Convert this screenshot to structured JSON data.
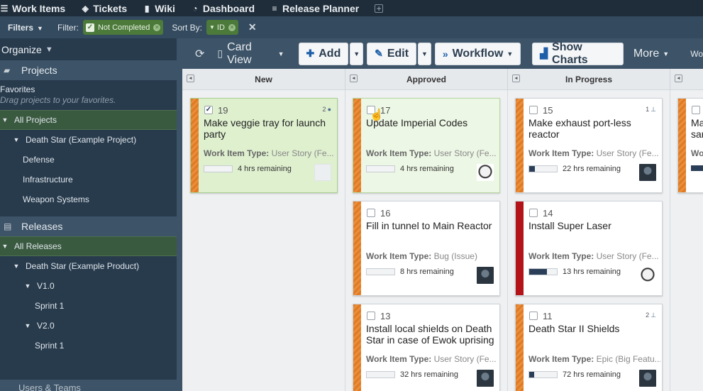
{
  "nav": {
    "tabs": [
      {
        "label": "Work Items",
        "icon": "list-icon"
      },
      {
        "label": "Tickets",
        "icon": "ticket-icon"
      },
      {
        "label": "Wiki",
        "icon": "document-icon"
      },
      {
        "label": "Dashboard",
        "icon": "dashboard-icon"
      },
      {
        "label": "Release Planner",
        "icon": "planner-icon"
      }
    ],
    "add_tab_icon": "plus-icon"
  },
  "filterbar": {
    "filters_label": "Filters",
    "filter_label": "Filter:",
    "filter_value": "Not Completed",
    "sortby_label": "Sort By:",
    "sort_value": "ID"
  },
  "sidebar": {
    "organize_label": "Organize",
    "projects_label": "Projects",
    "favorites_title": "Favorites",
    "favorites_hint": "Drag projects to your favorites.",
    "all_projects": "All Projects",
    "project_items": [
      "Death Star (Example Project)",
      "Defense",
      "Infrastructure",
      "Weapon Systems"
    ],
    "releases_label": "Releases",
    "all_releases": "All Releases",
    "release_items": [
      "Death Star (Example Product)",
      "V1.0",
      "Sprint 1",
      "V2.0",
      "Sprint 1"
    ],
    "users_label": "Users & Teams"
  },
  "toolbar": {
    "view_label": "Card View",
    "add_label": "Add",
    "edit_label": "Edit",
    "workflow_label": "Workflow",
    "charts_label": "Show Charts",
    "more_label": "More",
    "cut_label": "Wo"
  },
  "columns": [
    "New",
    "Approved",
    "In Progress"
  ],
  "cards": {
    "c19": {
      "id": "19",
      "title": "Make veggie tray for launch party",
      "type_label": "Work Item Type:",
      "type_value": "User Story (Fe...",
      "remaining": "4 hrs remaining",
      "badge": "2",
      "checked": "✓",
      "progress": 0
    },
    "c17": {
      "id": "17",
      "title": "Update Imperial Codes",
      "type_label": "Work Item Type:",
      "type_value": "User Story (Fe...",
      "remaining": "4 hrs remaining",
      "progress": 0
    },
    "c15": {
      "id": "15",
      "title": "Make exhaust port-less reactor",
      "type_label": "Work Item Type:",
      "type_value": "User Story (Fe...",
      "remaining": "22 hrs remaining",
      "badge": "1",
      "progress": 0.2
    },
    "c16": {
      "id": "16",
      "title": "Fill in tunnel to Main Reactor",
      "type_label": "Work Item Type:",
      "type_value": "Bug (Issue)",
      "remaining": "8 hrs remaining",
      "progress": 0
    },
    "c14": {
      "id": "14",
      "title": "Install Super Laser",
      "type_label": "Work Item Type:",
      "type_value": "User Story (Fe...",
      "remaining": "13 hrs remaining",
      "progress": 0.65
    },
    "c13": {
      "id": "13",
      "title": "Install local shields on Death Star in case of Ewok uprising",
      "type_label": "Work Item Type:",
      "type_value": "User Story (Fe...",
      "remaining": "32 hrs remaining",
      "progress": 0
    },
    "c11": {
      "id": "11",
      "title": "Death Star II Shields",
      "type_label": "Work Item Type:",
      "type_value": "Epic (Big Featu...",
      "remaining": "72 hrs remaining",
      "badge": "2",
      "progress": 0.18
    },
    "partial_top": {
      "title": "Ma sar",
      "type_label": "Wo"
    }
  }
}
